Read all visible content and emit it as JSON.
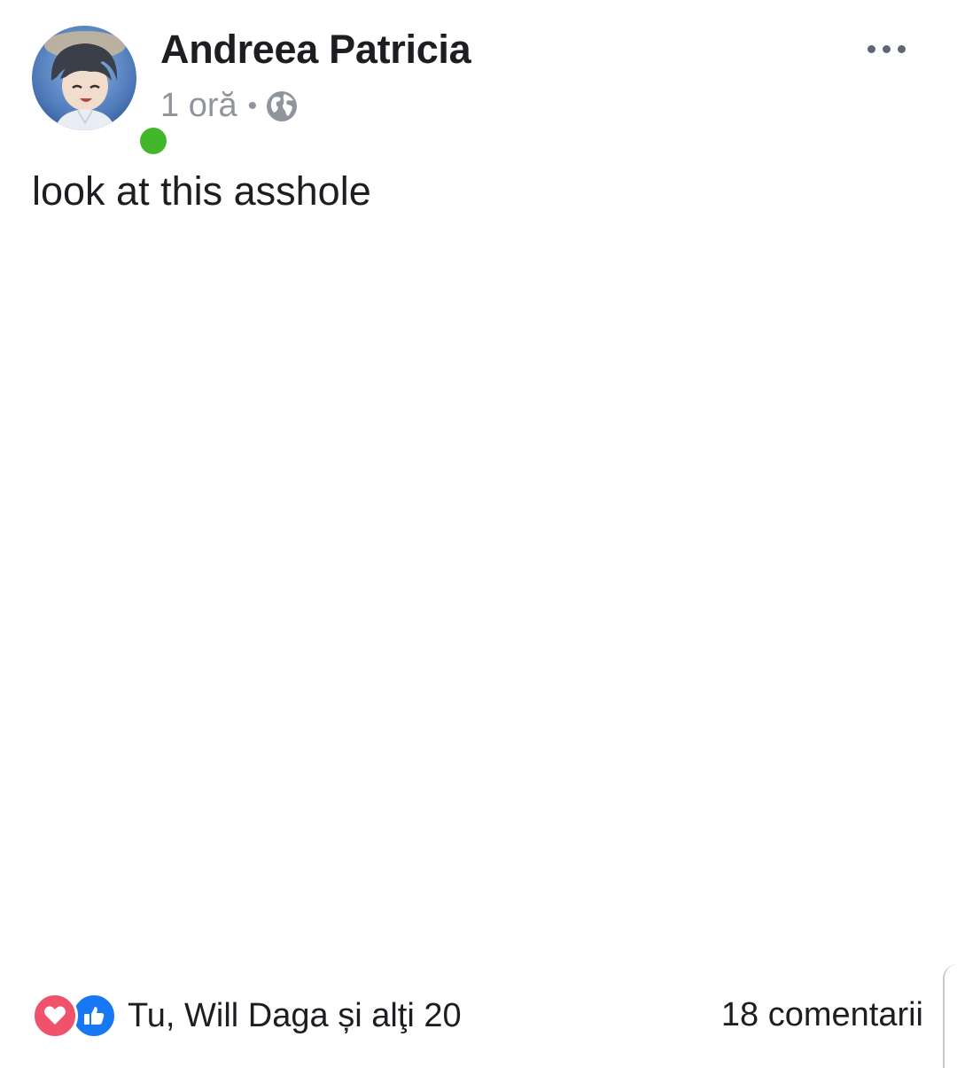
{
  "post": {
    "author": "Andreea Patricia",
    "time": "1 oră",
    "separator": "•",
    "privacy_icon": "globe-icon",
    "more_icon": "more-horizontal-icon",
    "text": "look at this asshole",
    "online": true
  },
  "footer": {
    "reaction_icons": [
      "heart-reaction-icon",
      "like-reaction-icon"
    ],
    "reactions_text": "Tu, Will Daga și alţi 20",
    "comments_text": "18 comentarii"
  },
  "colors": {
    "online": "#42b72a",
    "heart": "#f0526b",
    "like": "#1877f2",
    "text": "#1c1e21",
    "meta": "#90949c"
  }
}
